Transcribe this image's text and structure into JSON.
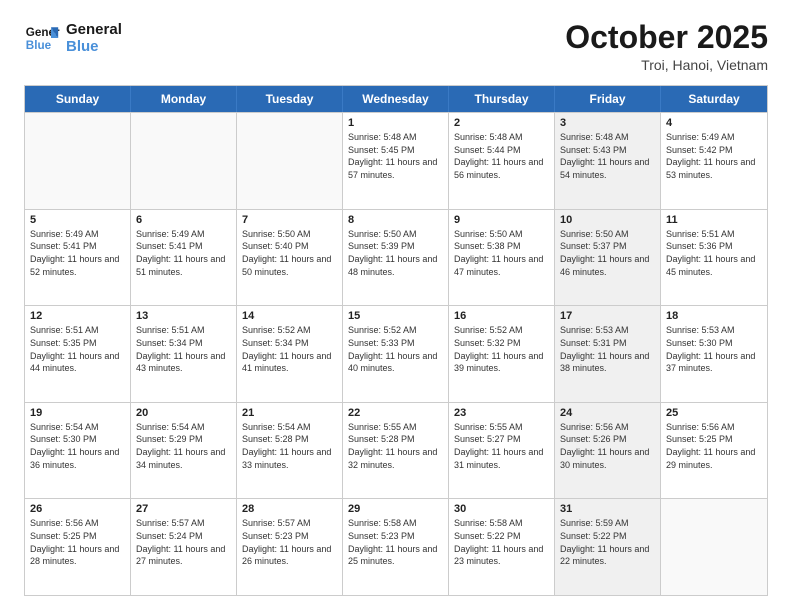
{
  "logo": {
    "line1": "General",
    "line2": "Blue"
  },
  "title": "October 2025",
  "location": "Troi, Hanoi, Vietnam",
  "days_of_week": [
    "Sunday",
    "Monday",
    "Tuesday",
    "Wednesday",
    "Thursday",
    "Friday",
    "Saturday"
  ],
  "rows": [
    [
      {
        "day": "",
        "sunrise": "",
        "sunset": "",
        "daylight": "",
        "shaded": false,
        "empty": true
      },
      {
        "day": "",
        "sunrise": "",
        "sunset": "",
        "daylight": "",
        "shaded": false,
        "empty": true
      },
      {
        "day": "",
        "sunrise": "",
        "sunset": "",
        "daylight": "",
        "shaded": false,
        "empty": true
      },
      {
        "day": "1",
        "sunrise": "Sunrise: 5:48 AM",
        "sunset": "Sunset: 5:45 PM",
        "daylight": "Daylight: 11 hours and 57 minutes.",
        "shaded": false,
        "empty": false
      },
      {
        "day": "2",
        "sunrise": "Sunrise: 5:48 AM",
        "sunset": "Sunset: 5:44 PM",
        "daylight": "Daylight: 11 hours and 56 minutes.",
        "shaded": false,
        "empty": false
      },
      {
        "day": "3",
        "sunrise": "Sunrise: 5:48 AM",
        "sunset": "Sunset: 5:43 PM",
        "daylight": "Daylight: 11 hours and 54 minutes.",
        "shaded": true,
        "empty": false
      },
      {
        "day": "4",
        "sunrise": "Sunrise: 5:49 AM",
        "sunset": "Sunset: 5:42 PM",
        "daylight": "Daylight: 11 hours and 53 minutes.",
        "shaded": false,
        "empty": false
      }
    ],
    [
      {
        "day": "5",
        "sunrise": "Sunrise: 5:49 AM",
        "sunset": "Sunset: 5:41 PM",
        "daylight": "Daylight: 11 hours and 52 minutes.",
        "shaded": false,
        "empty": false
      },
      {
        "day": "6",
        "sunrise": "Sunrise: 5:49 AM",
        "sunset": "Sunset: 5:41 PM",
        "daylight": "Daylight: 11 hours and 51 minutes.",
        "shaded": false,
        "empty": false
      },
      {
        "day": "7",
        "sunrise": "Sunrise: 5:50 AM",
        "sunset": "Sunset: 5:40 PM",
        "daylight": "Daylight: 11 hours and 50 minutes.",
        "shaded": false,
        "empty": false
      },
      {
        "day": "8",
        "sunrise": "Sunrise: 5:50 AM",
        "sunset": "Sunset: 5:39 PM",
        "daylight": "Daylight: 11 hours and 48 minutes.",
        "shaded": false,
        "empty": false
      },
      {
        "day": "9",
        "sunrise": "Sunrise: 5:50 AM",
        "sunset": "Sunset: 5:38 PM",
        "daylight": "Daylight: 11 hours and 47 minutes.",
        "shaded": false,
        "empty": false
      },
      {
        "day": "10",
        "sunrise": "Sunrise: 5:50 AM",
        "sunset": "Sunset: 5:37 PM",
        "daylight": "Daylight: 11 hours and 46 minutes.",
        "shaded": true,
        "empty": false
      },
      {
        "day": "11",
        "sunrise": "Sunrise: 5:51 AM",
        "sunset": "Sunset: 5:36 PM",
        "daylight": "Daylight: 11 hours and 45 minutes.",
        "shaded": false,
        "empty": false
      }
    ],
    [
      {
        "day": "12",
        "sunrise": "Sunrise: 5:51 AM",
        "sunset": "Sunset: 5:35 PM",
        "daylight": "Daylight: 11 hours and 44 minutes.",
        "shaded": false,
        "empty": false
      },
      {
        "day": "13",
        "sunrise": "Sunrise: 5:51 AM",
        "sunset": "Sunset: 5:34 PM",
        "daylight": "Daylight: 11 hours and 43 minutes.",
        "shaded": false,
        "empty": false
      },
      {
        "day": "14",
        "sunrise": "Sunrise: 5:52 AM",
        "sunset": "Sunset: 5:34 PM",
        "daylight": "Daylight: 11 hours and 41 minutes.",
        "shaded": false,
        "empty": false
      },
      {
        "day": "15",
        "sunrise": "Sunrise: 5:52 AM",
        "sunset": "Sunset: 5:33 PM",
        "daylight": "Daylight: 11 hours and 40 minutes.",
        "shaded": false,
        "empty": false
      },
      {
        "day": "16",
        "sunrise": "Sunrise: 5:52 AM",
        "sunset": "Sunset: 5:32 PM",
        "daylight": "Daylight: 11 hours and 39 minutes.",
        "shaded": false,
        "empty": false
      },
      {
        "day": "17",
        "sunrise": "Sunrise: 5:53 AM",
        "sunset": "Sunset: 5:31 PM",
        "daylight": "Daylight: 11 hours and 38 minutes.",
        "shaded": true,
        "empty": false
      },
      {
        "day": "18",
        "sunrise": "Sunrise: 5:53 AM",
        "sunset": "Sunset: 5:30 PM",
        "daylight": "Daylight: 11 hours and 37 minutes.",
        "shaded": false,
        "empty": false
      }
    ],
    [
      {
        "day": "19",
        "sunrise": "Sunrise: 5:54 AM",
        "sunset": "Sunset: 5:30 PM",
        "daylight": "Daylight: 11 hours and 36 minutes.",
        "shaded": false,
        "empty": false
      },
      {
        "day": "20",
        "sunrise": "Sunrise: 5:54 AM",
        "sunset": "Sunset: 5:29 PM",
        "daylight": "Daylight: 11 hours and 34 minutes.",
        "shaded": false,
        "empty": false
      },
      {
        "day": "21",
        "sunrise": "Sunrise: 5:54 AM",
        "sunset": "Sunset: 5:28 PM",
        "daylight": "Daylight: 11 hours and 33 minutes.",
        "shaded": false,
        "empty": false
      },
      {
        "day": "22",
        "sunrise": "Sunrise: 5:55 AM",
        "sunset": "Sunset: 5:28 PM",
        "daylight": "Daylight: 11 hours and 32 minutes.",
        "shaded": false,
        "empty": false
      },
      {
        "day": "23",
        "sunrise": "Sunrise: 5:55 AM",
        "sunset": "Sunset: 5:27 PM",
        "daylight": "Daylight: 11 hours and 31 minutes.",
        "shaded": false,
        "empty": false
      },
      {
        "day": "24",
        "sunrise": "Sunrise: 5:56 AM",
        "sunset": "Sunset: 5:26 PM",
        "daylight": "Daylight: 11 hours and 30 minutes.",
        "shaded": true,
        "empty": false
      },
      {
        "day": "25",
        "sunrise": "Sunrise: 5:56 AM",
        "sunset": "Sunset: 5:25 PM",
        "daylight": "Daylight: 11 hours and 29 minutes.",
        "shaded": false,
        "empty": false
      }
    ],
    [
      {
        "day": "26",
        "sunrise": "Sunrise: 5:56 AM",
        "sunset": "Sunset: 5:25 PM",
        "daylight": "Daylight: 11 hours and 28 minutes.",
        "shaded": false,
        "empty": false
      },
      {
        "day": "27",
        "sunrise": "Sunrise: 5:57 AM",
        "sunset": "Sunset: 5:24 PM",
        "daylight": "Daylight: 11 hours and 27 minutes.",
        "shaded": false,
        "empty": false
      },
      {
        "day": "28",
        "sunrise": "Sunrise: 5:57 AM",
        "sunset": "Sunset: 5:23 PM",
        "daylight": "Daylight: 11 hours and 26 minutes.",
        "shaded": false,
        "empty": false
      },
      {
        "day": "29",
        "sunrise": "Sunrise: 5:58 AM",
        "sunset": "Sunset: 5:23 PM",
        "daylight": "Daylight: 11 hours and 25 minutes.",
        "shaded": false,
        "empty": false
      },
      {
        "day": "30",
        "sunrise": "Sunrise: 5:58 AM",
        "sunset": "Sunset: 5:22 PM",
        "daylight": "Daylight: 11 hours and 23 minutes.",
        "shaded": false,
        "empty": false
      },
      {
        "day": "31",
        "sunrise": "Sunrise: 5:59 AM",
        "sunset": "Sunset: 5:22 PM",
        "daylight": "Daylight: 11 hours and 22 minutes.",
        "shaded": true,
        "empty": false
      },
      {
        "day": "",
        "sunrise": "",
        "sunset": "",
        "daylight": "",
        "shaded": false,
        "empty": true
      }
    ]
  ]
}
